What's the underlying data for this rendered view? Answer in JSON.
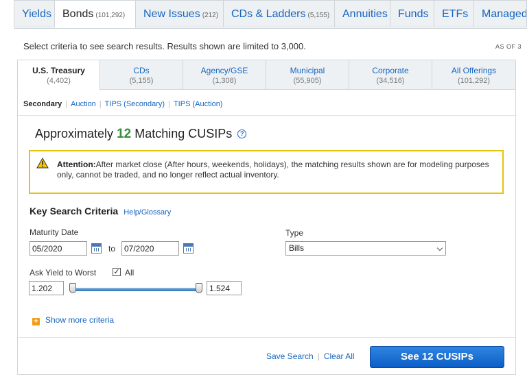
{
  "top_tabs": [
    {
      "label": "Yields",
      "count": ""
    },
    {
      "label": "Bonds",
      "count": "(101,292)"
    },
    {
      "label": "New Issues",
      "count": "(212)"
    },
    {
      "label": "CDs & Ladders",
      "count": "(5,155)"
    },
    {
      "label": "Annuities",
      "count": ""
    },
    {
      "label": "Funds",
      "count": ""
    },
    {
      "label": "ETFs",
      "count": ""
    },
    {
      "label": "Managed A",
      "count": ""
    }
  ],
  "select_text": "Select criteria to see search results. Results shown are limited to 3,000.",
  "as_of": "AS OF 3",
  "security_tabs": [
    {
      "label": "U.S. Treasury",
      "count": "(4,402)"
    },
    {
      "label": "CDs",
      "count": "(5,155)"
    },
    {
      "label": "Agency/GSE",
      "count": "(1,308)"
    },
    {
      "label": "Municipal",
      "count": "(55,905)"
    },
    {
      "label": "Corporate",
      "count": "(34,516)"
    },
    {
      "label": "All Offerings",
      "count": "(101,292)"
    }
  ],
  "market_tabs": [
    "Secondary",
    "Auction",
    "TIPS (Secondary)",
    "TIPS (Auction)"
  ],
  "matching": {
    "prefix": "Approximately",
    "count": "12",
    "suffix": "Matching CUSIPs",
    "help_icon": "?"
  },
  "attention": {
    "title": "Attention:",
    "text": "After market close (After hours, weekends, holidays), the matching results shown are for modeling purposes only, cannot be traded, and no longer reflect actual inventory."
  },
  "criteria": {
    "heading": "Key Search Criteria",
    "help_link": "Help/Glossary",
    "maturity_label": "Maturity Date",
    "maturity_from": "05/2020",
    "to_label": "to",
    "maturity_to": "07/2020",
    "type_label": "Type",
    "type_value": "Bills",
    "yield_label": "Ask Yield to Worst",
    "all_label": "All",
    "all_checked": "✓",
    "yield_min": "1.202",
    "yield_max": "1.524",
    "show_more": "Show more criteria",
    "plus": "+"
  },
  "actions": {
    "save": "Save Search",
    "clear": "Clear All",
    "see": "See 12 CUSIPs"
  },
  "colors": {
    "link": "#1565c0",
    "count_green": "#388e3c",
    "attention_border": "#e5c410",
    "button": "#0b5ec7"
  },
  "icons": {
    "warning": "warning-icon",
    "calendar": "calendar-icon",
    "help": "help-icon",
    "plus": "plus-icon",
    "dropdown": "chevron-down-icon"
  }
}
